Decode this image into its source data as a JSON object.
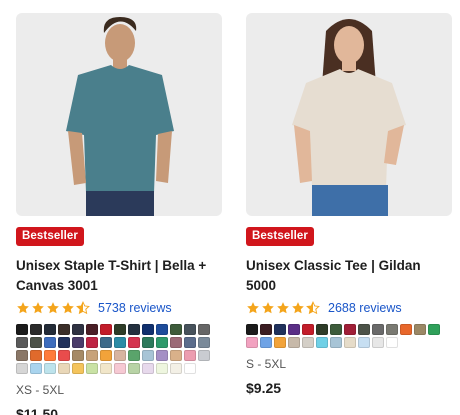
{
  "products": [
    {
      "badge": "Bestseller",
      "title": "Unisex Staple T-Shirt | Bella + Canvas 3001",
      "rating": 4.5,
      "reviews": "5738 reviews",
      "sizes": "XS - 5XL",
      "price": "$11.50",
      "image_shirt_color": "#4a7f8c",
      "swatches": [
        "#1b1b1b",
        "#2a2a2a",
        "#232b37",
        "#3a2e28",
        "#2f3242",
        "#4a1e26",
        "#c21d2a",
        "#2e3c28",
        "#23303f",
        "#10306e",
        "#1d4c9b",
        "#3d5b3a",
        "#47525b",
        "#666666",
        "#5a5a5a",
        "#4c5248",
        "#3d6dbd",
        "#20315c",
        "#4b3c6b",
        "#be2443",
        "#3c6a8a",
        "#2b8ba6",
        "#d4334f",
        "#2d7a5c",
        "#2e9a6b",
        "#9b6a77",
        "#5b6d8c",
        "#7a8a9a",
        "#8a7767",
        "#e06a2c",
        "#ff7b3b",
        "#e94c4c",
        "#a68a66",
        "#c7a27a",
        "#f2a33a",
        "#d7b4a0",
        "#5aa46b",
        "#a7c4d6",
        "#a48fc5",
        "#d9b18a",
        "#ec9db0",
        "#c9ccd1",
        "#d6d6d6",
        "#a9d4ee",
        "#bde3ec",
        "#e9d7b8",
        "#f4c45c",
        "#c9e2a5",
        "#f1e6c9",
        "#f6c9d3",
        "#b8d3a6",
        "#e7d9ec",
        "#eef6df",
        "#f3f0e6",
        "#ffffff"
      ]
    },
    {
      "badge": "Bestseller",
      "title": "Unisex Classic Tee | Gildan 5000",
      "rating": 4.5,
      "reviews": "2688 reviews",
      "sizes": "S - 5XL",
      "price": "$9.25",
      "image_shirt_color": "#e6ddd1",
      "swatches": [
        "#1b1b1b",
        "#3b1d22",
        "#20315c",
        "#5a2e86",
        "#c21d2a",
        "#2e3c28",
        "#3d5b3a",
        "#a01f37",
        "#4c5248",
        "#6a6a6a",
        "#7a7a72",
        "#e8672b",
        "#9b8866",
        "#2fa05a",
        "#f2a2c0",
        "#6fa3e6",
        "#f2a33a",
        "#c7b9a9",
        "#d4cfc7",
        "#6fd0e6",
        "#a7c4d6",
        "#e6dcc9",
        "#c7dff2",
        "#e7e7e7",
        "#ffffff"
      ]
    }
  ]
}
